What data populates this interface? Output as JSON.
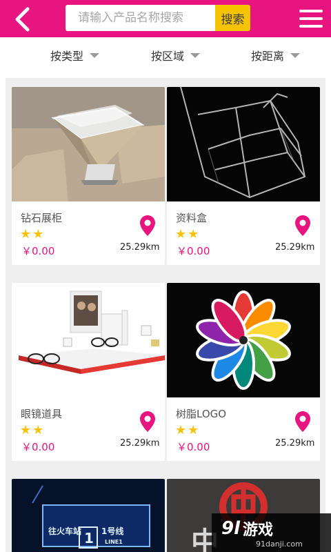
{
  "header": {
    "search_placeholder": "请输入产品名称搜索",
    "search_button": "搜索",
    "back_icon": "back-chevron-icon",
    "menu_icon": "hamburger-menu-icon",
    "accent_color": "#e8147f",
    "search_button_color": "#f6c300"
  },
  "filters": [
    {
      "label": "按类型"
    },
    {
      "label": "按区域"
    },
    {
      "label": "按距离"
    }
  ],
  "products": [
    {
      "name": "钻石展柜",
      "stars": "★★",
      "price": "￥0.00",
      "distance": "25.29km"
    },
    {
      "name": "资料盒",
      "stars": "★★",
      "price": "￥0.00",
      "distance": "25.29km"
    },
    {
      "name": "眼镜道具",
      "stars": "★★",
      "price": "￥0.00",
      "distance": "25.29km"
    },
    {
      "name": "树脂LOGO",
      "stars": "★★",
      "price": "￥0.00",
      "distance": "25.29km"
    }
  ],
  "partial_products": [
    {
      "sign_station": "往火车站",
      "sign_number": "1",
      "sign_line": "1号线",
      "sign_line_en": "LINE1"
    },
    {
      "sign_char": "中"
    }
  ],
  "watermark": {
    "logo": "9l",
    "text": "游戏",
    "url": "91danji.com"
  }
}
